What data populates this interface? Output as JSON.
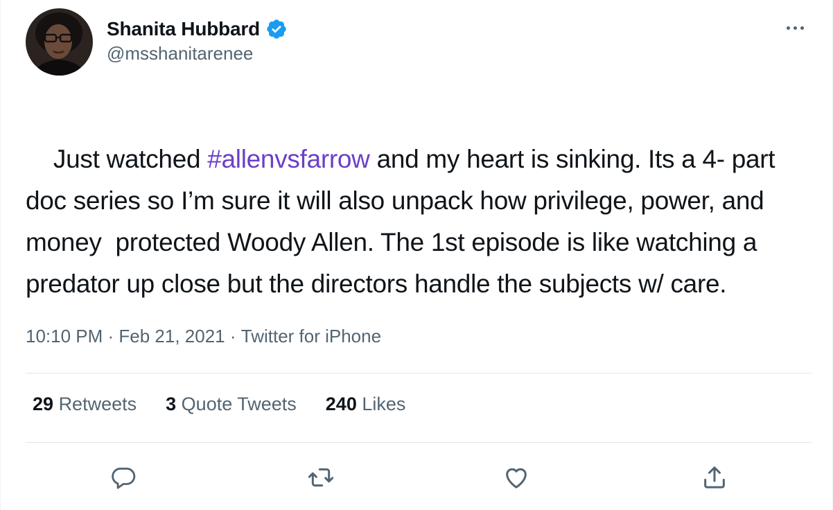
{
  "tweet": {
    "author": {
      "display_name": "Shanita Hubbard",
      "handle": "@msshanitarenee",
      "verified": true
    },
    "text_parts": [
      {
        "type": "text",
        "value": "Just watched "
      },
      {
        "type": "hashtag",
        "value": "#allenvsfarrow"
      },
      {
        "type": "text",
        "value": " and my heart is sinking. Its a 4- part doc series so I’m sure it will also unpack how privilege, power, and money  protected Woody Allen. The 1st episode is like watching a predator up close but the directors handle the subjects w/ care."
      }
    ],
    "time": "10:10 PM",
    "separator": " · ",
    "date": "Feb 21, 2021",
    "source": "Twitter for iPhone",
    "stats": {
      "retweets_count": "29",
      "retweets_label": "Retweets",
      "quotes_count": "3",
      "quotes_label": "Quote Tweets",
      "likes_count": "240",
      "likes_label": "Likes"
    }
  },
  "icons": {
    "more": "more-horizontal-icon",
    "verified": "verified-badge-icon",
    "reply": "reply-icon",
    "retweet": "retweet-icon",
    "like": "heart-icon",
    "share": "share-icon"
  },
  "colors": {
    "hashtag": "#6b3fc9",
    "verified": "#1d9bf0",
    "secondary_text": "#536471",
    "primary_text": "#0f1419"
  }
}
